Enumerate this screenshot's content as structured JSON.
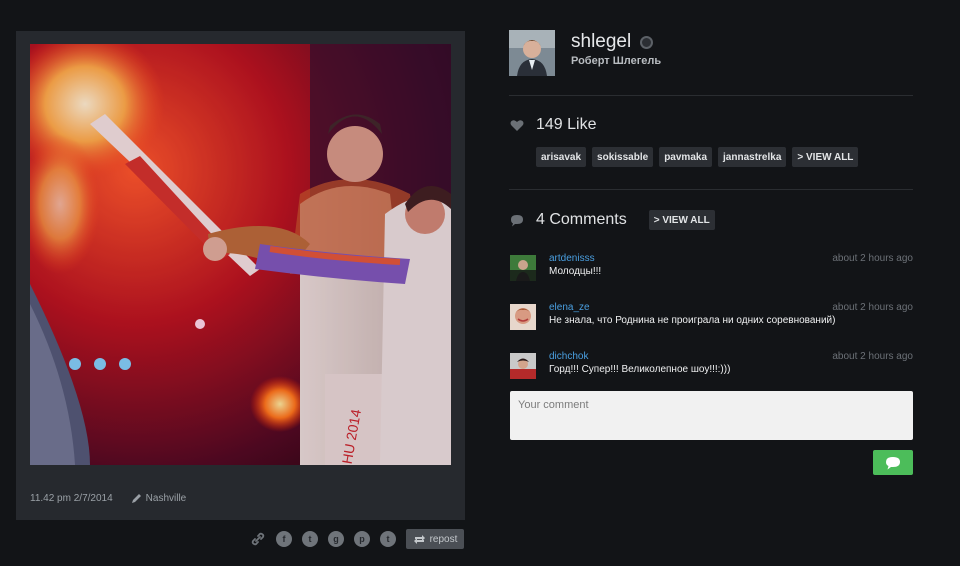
{
  "post": {
    "time": "11.42 pm 2/7/2014",
    "location": "Nashville",
    "repost_label": "repost",
    "share_icons": [
      "link-icon",
      "facebook-icon",
      "twitter-icon",
      "google-plus-icon",
      "pinterest-icon",
      "tumblr-icon"
    ]
  },
  "user": {
    "username": "shlegel",
    "full_name": "Роберт Шлегель"
  },
  "likes": {
    "label": "149 Like",
    "users": [
      "arisavak",
      "sokissable",
      "pavmaka",
      "jannastrelka"
    ],
    "view_all": "> VIEW ALL"
  },
  "comments": {
    "label": "4 Comments",
    "view_all": "> VIEW ALL",
    "items": [
      {
        "user": "artdenisss",
        "time": "about 2 hours ago",
        "text": "Молодцы!!!"
      },
      {
        "user": "elena_ze",
        "time": "about 2 hours ago",
        "text": "Не знала, что Роднина не проиграла ни одних соревнований)"
      },
      {
        "user": "dichchok",
        "time": "about 2 hours ago",
        "text": "Горд!!! Супер!!! Великолепное шоу!!!:)))"
      }
    ],
    "input_placeholder": "Your comment"
  },
  "colors": {
    "background": "#121417",
    "card": "#26292e",
    "link_blue": "#4a9fe0",
    "send_green": "#4cbd5a"
  }
}
